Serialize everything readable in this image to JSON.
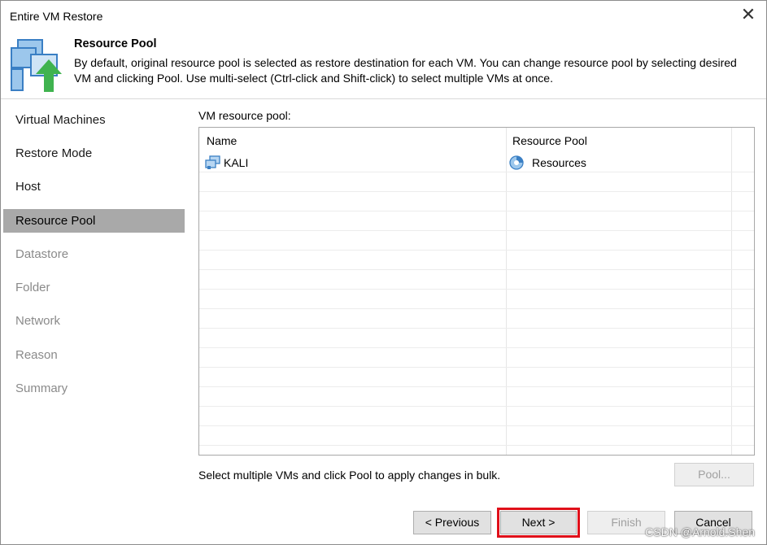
{
  "window": {
    "title": "Entire VM Restore"
  },
  "header": {
    "title": "Resource Pool",
    "description": "By default, original resource pool is selected as restore destination for each VM. You can change resource pool by selecting desired VM and clicking Pool. Use multi-select (Ctrl-click and Shift-click) to select multiple VMs at once."
  },
  "sidebar": {
    "items": [
      {
        "label": "Virtual Machines",
        "state": "done"
      },
      {
        "label": "Restore Mode",
        "state": "done"
      },
      {
        "label": "Host",
        "state": "done"
      },
      {
        "label": "Resource Pool",
        "state": "active"
      },
      {
        "label": "Datastore",
        "state": "pending"
      },
      {
        "label": "Folder",
        "state": "pending"
      },
      {
        "label": "Network",
        "state": "pending"
      },
      {
        "label": "Reason",
        "state": "pending"
      },
      {
        "label": "Summary",
        "state": "pending"
      }
    ]
  },
  "main": {
    "section_label": "VM resource pool:",
    "table": {
      "columns": [
        "Name",
        "Resource Pool"
      ],
      "rows": [
        {
          "name": "KALI",
          "name_icon": "vm-icon",
          "pool": "Resources",
          "pool_icon": "resource-pool-icon"
        }
      ]
    },
    "hint": "Select multiple VMs and click Pool to apply changes in bulk.",
    "pool_button": "Pool..."
  },
  "footer": {
    "previous": "< Previous",
    "next": "Next >",
    "finish": "Finish",
    "cancel": "Cancel"
  },
  "watermark": "CSDN @Arnold.Shen",
  "colors": {
    "active_nav": "#a9a9a9",
    "highlight": "#e0101a",
    "accent_green": "#3fb34f",
    "accent_blue": "#3a7fc4"
  }
}
